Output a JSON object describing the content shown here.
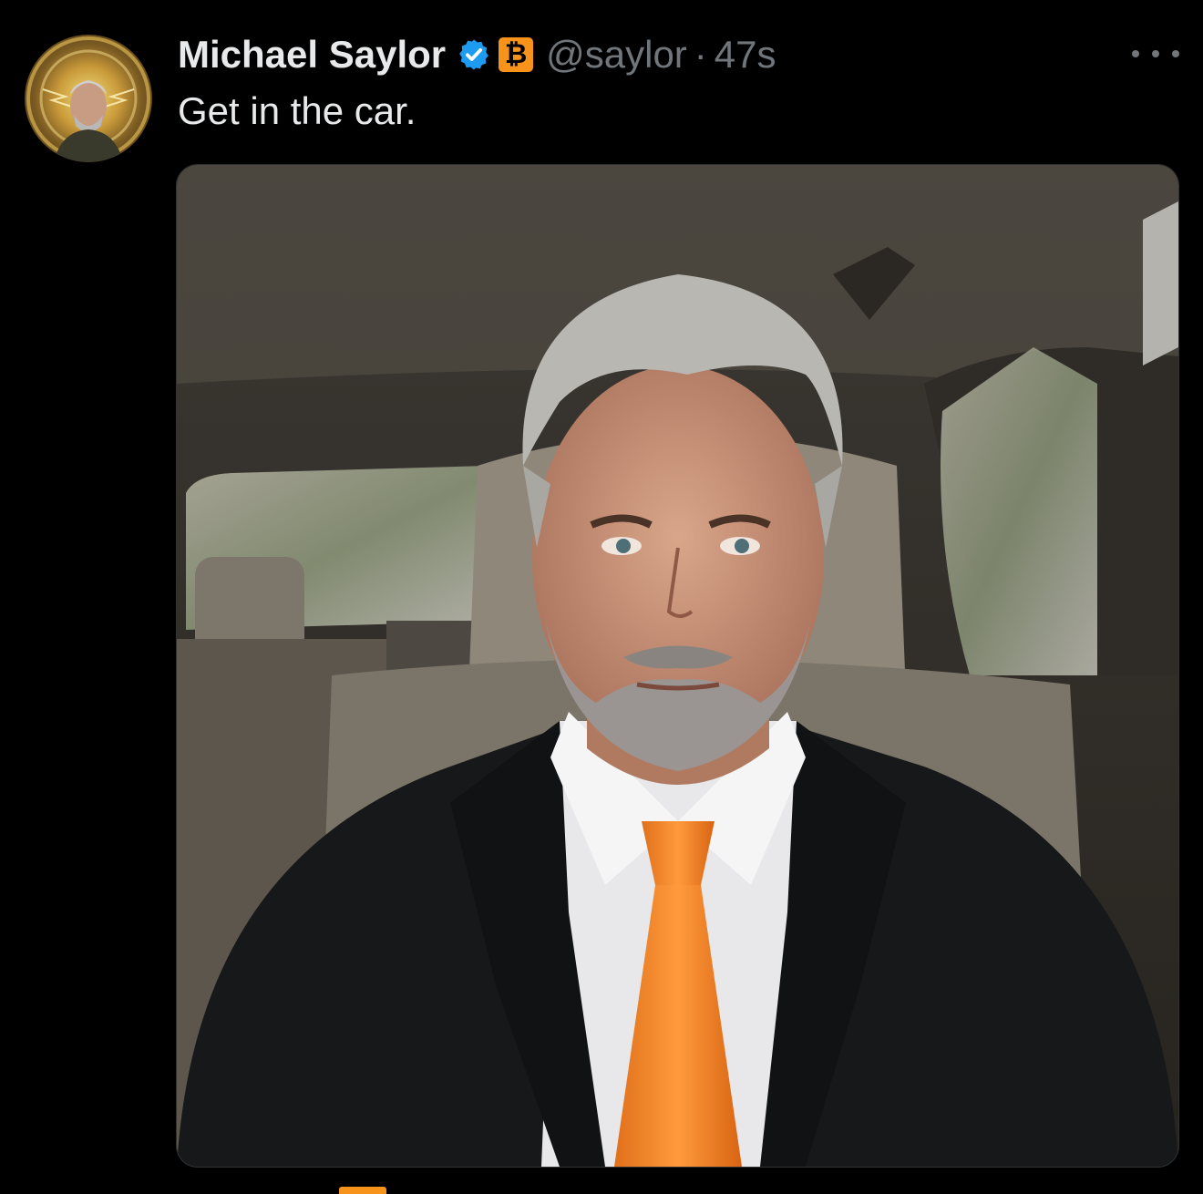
{
  "tweet": {
    "author_name": "Michael Saylor",
    "handle": "@saylor",
    "separator": "·",
    "time": "47s",
    "text": "Get in the car.",
    "badge_glyph": "₿",
    "more_icon": "more-horizontal-icon",
    "verified_icon": "verified-badge-icon"
  },
  "colors": {
    "background": "#000000",
    "text": "#e7e9ea",
    "muted": "#71767b",
    "verified": "#1d9bf0",
    "bitcoin": "#f7931a"
  }
}
